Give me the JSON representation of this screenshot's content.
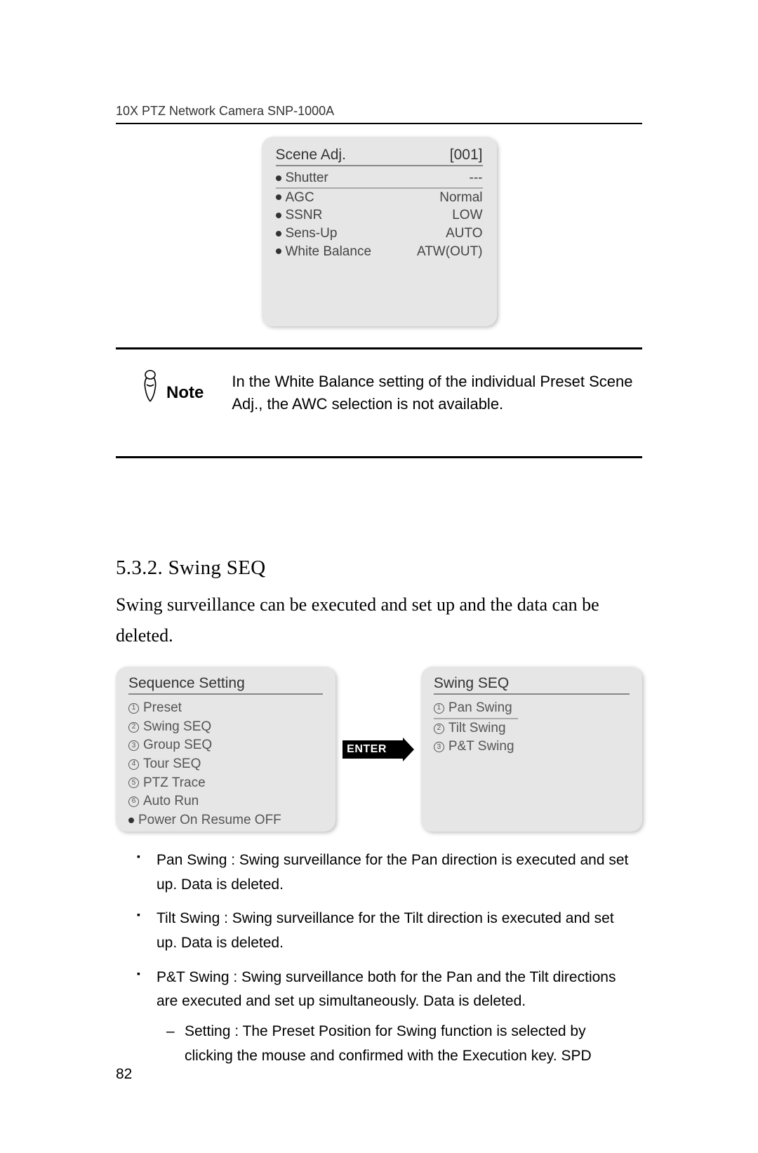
{
  "header": "10X PTZ Network Camera SNP-1000A",
  "scene_adj": {
    "title": "Scene Adj.",
    "index": "[001]",
    "items": [
      {
        "label": "Shutter",
        "value": "---"
      },
      {
        "label": "AGC",
        "value": "Normal"
      },
      {
        "label": "SSNR",
        "value": "LOW"
      },
      {
        "label": "Sens-Up",
        "value": "AUTO"
      },
      {
        "label": "White Balance",
        "value": "ATW(OUT)"
      }
    ]
  },
  "note": {
    "label": "Note",
    "text": "In the White Balance setting of the individual Preset Scene Adj., the AWC selection is not available."
  },
  "section": {
    "heading": "5.3.2. Swing SEQ",
    "body": "Swing surveillance can be executed and set up and the data can be deleted."
  },
  "seq_setting": {
    "title": "Sequence Setting",
    "items": [
      "Preset",
      "Swing SEQ",
      "Group SEQ",
      "Tour SEQ",
      "PTZ Trace",
      "Auto Run"
    ],
    "last_line": "Power On Resume OFF"
  },
  "enter_label": "ENTER",
  "swing_seq": {
    "title": "Swing SEQ",
    "items": [
      "Pan Swing",
      "Tilt Swing",
      "P&T Swing"
    ]
  },
  "bullets": [
    "Pan Swing : Swing surveillance for the Pan direction is executed and set up. Data is deleted.",
    "Tilt Swing : Swing surveillance for the Tilt direction is executed and set up. Data is deleted.",
    "P&T Swing : Swing surveillance both for the Pan and the Tilt directions are executed and set up simultaneously. Data is deleted."
  ],
  "sub_bullet": "Setting : The Preset Position for Swing function is selected by clicking the mouse and confirmed with the Execution key. SPD",
  "page_number": "82"
}
